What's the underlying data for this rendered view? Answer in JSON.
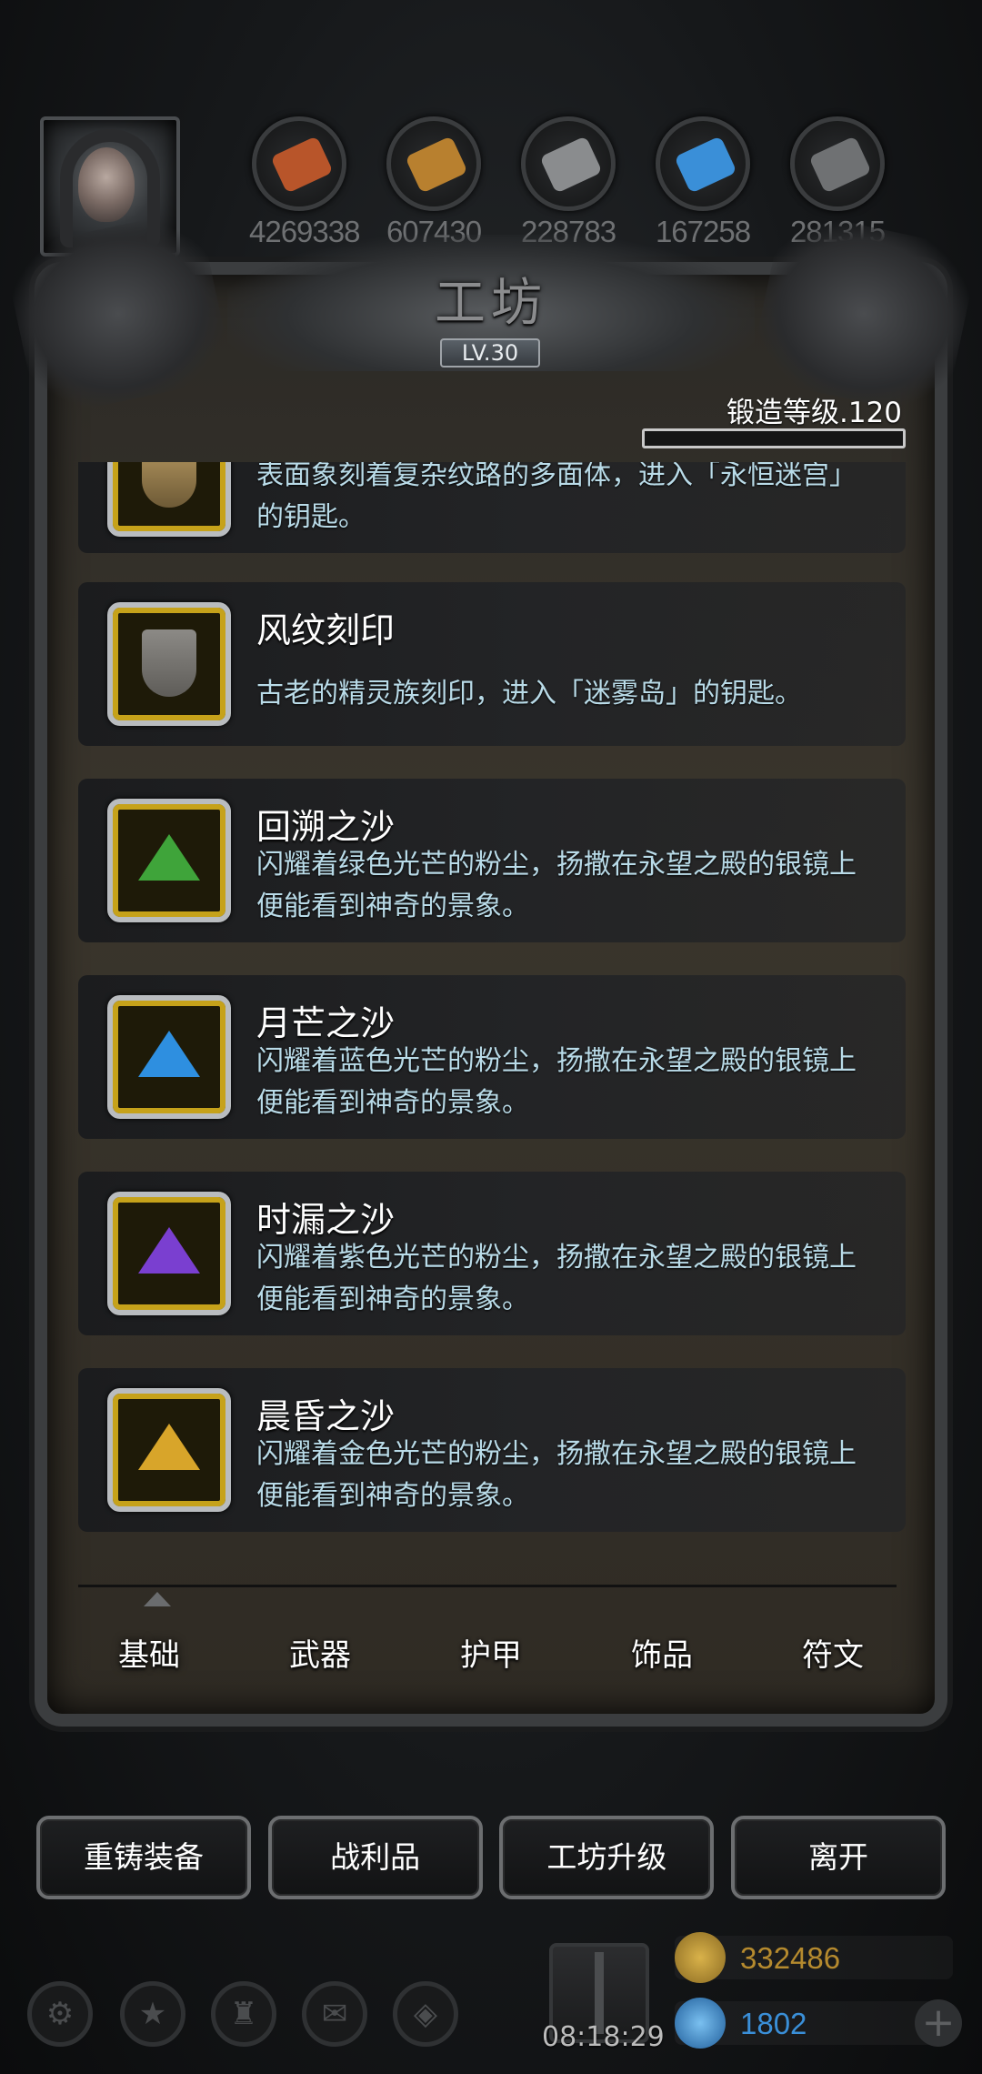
{
  "resources": [
    {
      "icon": "ore-orb-icon",
      "value": "4269338",
      "color": "#b8552a"
    },
    {
      "icon": "wood-planks-icon",
      "value": "607430",
      "color": "#b8802f"
    },
    {
      "icon": "iron-ingot-icon",
      "value": "228783",
      "color": "#8a8c8e"
    },
    {
      "icon": "crystal-icon",
      "value": "167258",
      "color": "#3a8fd8"
    },
    {
      "icon": "steel-plate-icon",
      "value": "281315",
      "color": "#6f7173"
    }
  ],
  "workshop": {
    "title": "工坊",
    "level_badge": "LV.30",
    "forge_level": "锻造等级.120"
  },
  "items": [
    {
      "name": "",
      "desc": "表面象刻着复杂纹路的多面体，进入「永恒迷宫」的钥匙。",
      "icon": "rune-shield-icon",
      "gem_color": ""
    },
    {
      "name": "风纹刻印",
      "desc": "古老的精灵族刻印，进入「迷雾岛」的钥匙。",
      "icon": "wind-seal-icon",
      "gem_color": ""
    },
    {
      "name": "回溯之沙",
      "desc": "闪耀着绿色光芒的粉尘，扬撒在永望之殿的银镜上便能看到神奇的景象。",
      "icon": "green-sand-icon",
      "gem_color": "#3fa43a"
    },
    {
      "name": "月芒之沙",
      "desc": "闪耀着蓝色光芒的粉尘，扬撒在永望之殿的银镜上便能看到神奇的景象。",
      "icon": "blue-sand-icon",
      "gem_color": "#2e8fe0"
    },
    {
      "name": "时漏之沙",
      "desc": "闪耀着紫色光芒的粉尘，扬撒在永望之殿的银镜上便能看到神奇的景象。",
      "icon": "purple-sand-icon",
      "gem_color": "#7a3fd0"
    },
    {
      "name": "晨昏之沙",
      "desc": "闪耀着金色光芒的粉尘，扬撒在永望之殿的银镜上便能看到神奇的景象。",
      "icon": "gold-sand-icon",
      "gem_color": "#d8a52a"
    }
  ],
  "tabs": [
    "基础",
    "武器",
    "护甲",
    "饰品",
    "符文"
  ],
  "buttons": [
    "重铸装备",
    "战利品",
    "工坊升级",
    "离开"
  ],
  "bottom_bar": {
    "icons": [
      "settings-icon",
      "star-icon",
      "castle-icon",
      "mail-icon",
      "cube-icon"
    ],
    "time": "08:18:29",
    "gold": "332486",
    "gems": "1802",
    "gold_color": "#b58a2e",
    "gem_color": "#3a8fd8"
  }
}
